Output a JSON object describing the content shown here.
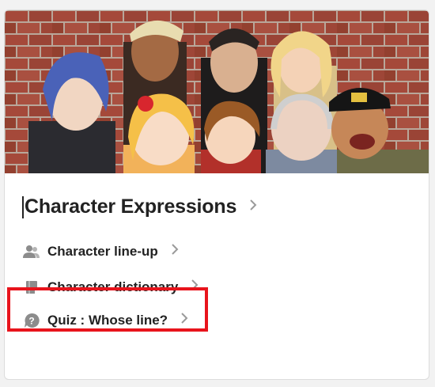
{
  "card": {
    "title": "Character Expressions",
    "links": [
      {
        "label": "Character line-up",
        "icon": "people-icon"
      },
      {
        "label": "Character dictionary",
        "icon": "book-icon"
      },
      {
        "label": "Quiz : Whose line?",
        "icon": "question-icon"
      }
    ]
  },
  "colors": {
    "highlight": "#e8141c",
    "text": "#222222",
    "chevron": "#9a9a9a",
    "brick": "#a0493a"
  }
}
